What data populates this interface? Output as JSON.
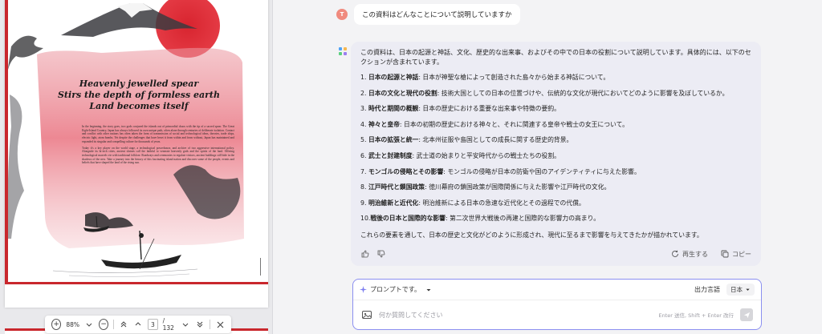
{
  "pdf": {
    "poem": [
      "Heavenly jewelled spear",
      "Stirs the depth of formless earth",
      "Land becomes itself"
    ],
    "paragraph1": "In the beginning, the story goes, two gods conjured the islands out of primordial chaos with the tip of a sacred spear. The Great Eight-Island Country, Japan has always followed its own unique path, often alone through centuries of deliberate isolation. Contact and conflict with other nations has often taken the form of transmission of social and technological ideas, theories, trade ships, electric light, atom bombs. Yet despite the challenges that have beset it from within and from without, Japan has maintained and expanded its singular and compelling culture for thousands of years.",
    "paragraph2": "Today it's a key player on the world stage, a technological powerhouse, and archive of two aggressive international policy. Alongside its hi-tech cities, ancient shrines call the faithful to venerate heavenly gods and the spirits of the land. Offering technological marvels vie with traditional folklore. Roadways and ceremonies to regulate visitors, ancient buildings still bide in the shadows of the new. Take a journey into the history of this fascinating island nation and discover some of the people, events and beliefs that have shaped the land of the rising sun.",
    "toolbar": {
      "zoom": "88%",
      "page_current": "3",
      "page_total": "/ 132"
    }
  },
  "chat": {
    "user_avatar": "T",
    "question": "この資料はどんなことについて説明していますか",
    "answer_intro": "この資料は、日本の起源と神話、文化、歴史的な出来事、およびその中での日本の役割について説明しています。具体的には、以下のセクションが含まれています。",
    "items": [
      {
        "num": "1.",
        "title": "日本の起源と神話",
        "desc": ": 日本が神聖な槍によって創造された島々から始まる神話について。"
      },
      {
        "num": "2.",
        "title": "日本の文化と現代の役割",
        "desc": ": 技術大国としての日本の位置づけや、伝統的な文化が現代においてどのように影響を及ぼしているか。"
      },
      {
        "num": "3.",
        "title": "時代と期間の概観",
        "desc": ": 日本の歴史における重要な出来事や特徴の要約。"
      },
      {
        "num": "4.",
        "title": "神々と皇帝",
        "desc": ": 日本の初期の歴史における神々と、それに関連する皇帝や戦士の女王について。"
      },
      {
        "num": "5.",
        "title": "日本の拡張と統一",
        "desc": ": 北本州征服や島国としての成長に関する歴史的背景。"
      },
      {
        "num": "6.",
        "title": "武士と封建制度",
        "desc": ": 武士道の始まりと平安時代からの戦士たちの役割。"
      },
      {
        "num": "7.",
        "title": "モンゴルの侵略とその影響",
        "desc": ": モンゴルの侵略が日本の防衛や国のアイデンティティに与えた影響。"
      },
      {
        "num": "8.",
        "title": "江戸時代と鎖国政策",
        "desc": ": 徳川幕府の鎖国政策が国際関係に与えた影響や江戸時代の文化。"
      },
      {
        "num": "9.",
        "title": "明治維新と近代化",
        "desc": ": 明治維新による日本の急速な近代化とその過程での代償。"
      },
      {
        "num": "10.",
        "title": "戦後の日本と国際的な影響",
        "desc": ": 第二次世界大戦後の再建と国際的な影響力の高まり。"
      }
    ],
    "answer_summary": "これらの要素を通して、日本の歴史と文化がどのように形成され、現代に至るまで影響を与えてきたかが描かれています。",
    "regenerate_label": "再生する",
    "copy_label": "コピー",
    "prompt_label": "プロンプトです。",
    "output_lang_label": "出力言語",
    "output_lang_value": "日本",
    "input_placeholder": "何か質問してください",
    "input_hint": "Enter 送信, Shift + Enter 改行"
  },
  "colors": {
    "accent": "#8b8ff0",
    "answer_bg": "#ececf4",
    "pdf_red": "#c9272d"
  }
}
